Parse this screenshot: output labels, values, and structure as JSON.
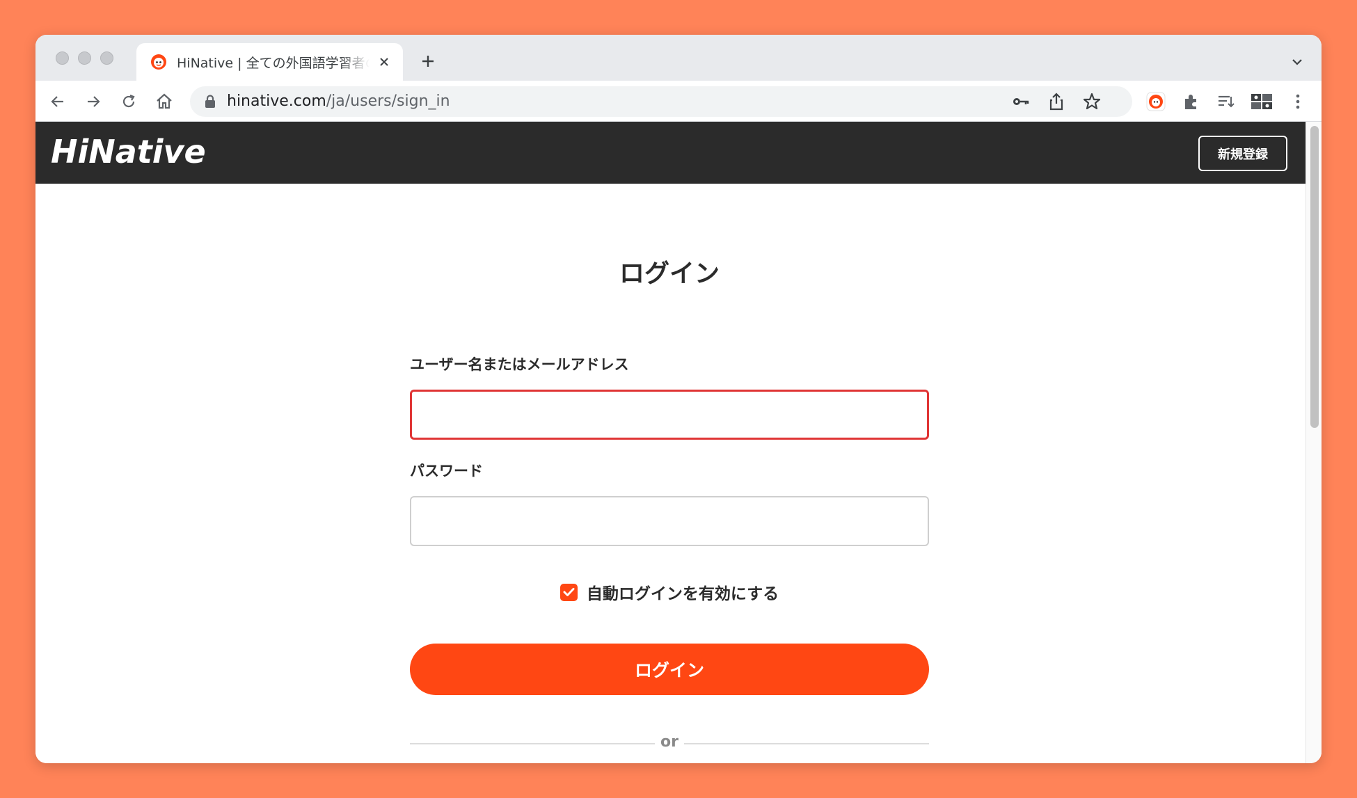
{
  "browser": {
    "tab_title": "HiNative | 全ての外国語学習者のた",
    "url_host": "hinative.com",
    "url_path": "/ja/users/sign_in"
  },
  "site": {
    "logo_text": "HiNative",
    "signup_label": "新規登録"
  },
  "login_form": {
    "title": "ログイン",
    "username_label": "ユーザー名またはメールアドレス",
    "username_value": "",
    "password_label": "パスワード",
    "password_value": "",
    "remember_label": "自動ログインを有効にする",
    "remember_checked": true,
    "submit_label": "ログイン",
    "divider_text": "or"
  },
  "colors": {
    "brand_orange": "#ff4713",
    "header_dark": "#2b2b2b",
    "error_border": "#e03535",
    "backdrop": "#ff8358"
  },
  "icons": [
    "hinative-favicon",
    "tab-close-icon",
    "new-tab-icon",
    "back-icon",
    "forward-icon",
    "reload-icon",
    "home-icon",
    "lock-icon",
    "key-icon",
    "share-icon",
    "star-icon",
    "extensions-icon",
    "reading-list-icon",
    "profile-icon",
    "menu-icon",
    "checkmark-icon",
    "chevron-down-icon"
  ]
}
